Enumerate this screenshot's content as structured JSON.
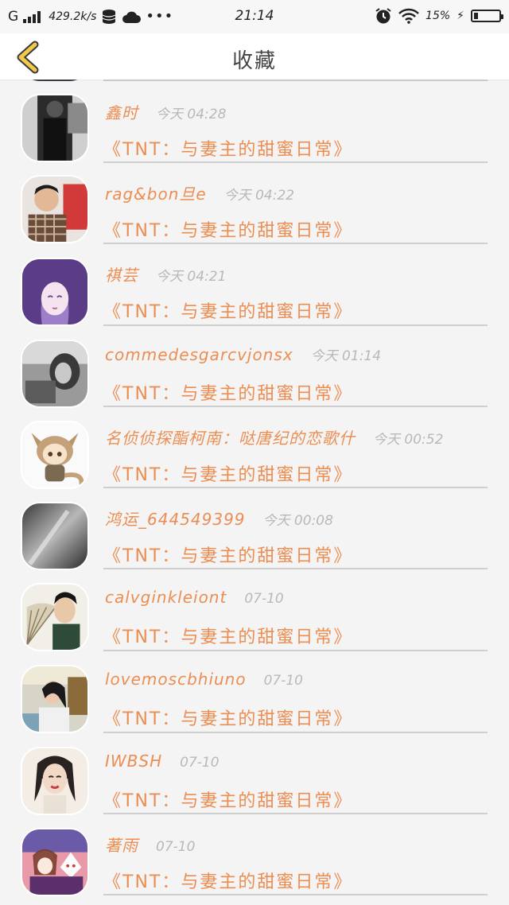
{
  "status_bar": {
    "network": "G",
    "speed": "429.2k/s",
    "time": "21:14",
    "battery": "15%",
    "battery_level": 0.15
  },
  "nav": {
    "title": "收藏"
  },
  "colors": {
    "accent": "#ec8d52",
    "back_arrow": "#f2c94c",
    "divider": "#cfcfcf",
    "time_text": "#b8b8b8"
  },
  "items": [
    {
      "name": "鑫时",
      "time": "今天 04:28",
      "title": "《TNT：与妻主的甜蜜日常》",
      "avatar": "avatar-dark-man"
    },
    {
      "name": "rag&bon旦e",
      "time": "今天 04:22",
      "title": "《TNT：与妻主的甜蜜日常》",
      "avatar": "avatar-boy-red"
    },
    {
      "name": "祺芸",
      "time": "今天 04:21",
      "title": "《TNT：与妻主的甜蜜日常》",
      "avatar": "avatar-anime-purple"
    },
    {
      "name": "commedesgarcvjonsx",
      "time": "今天 01:14",
      "title": "《TNT：与妻主的甜蜜日常》",
      "avatar": "avatar-bw-girl"
    },
    {
      "name": "名侦侦探酯柯南：哒唐纪的恋歌什",
      "time": "今天 00:52",
      "title": "《TNT：与妻主的甜蜜日常》",
      "avatar": "avatar-chibi-fox"
    },
    {
      "name": "鸿运_644549399",
      "time": "今天 00:08",
      "title": "《TNT：与妻主的甜蜜日常》",
      "avatar": "avatar-gray-blur"
    },
    {
      "name": "calvginkleiont",
      "time": "07-10",
      "title": "《TNT：与妻主的甜蜜日常》",
      "avatar": "avatar-fan-woman"
    },
    {
      "name": "lovemoscbhiuno",
      "time": "07-10",
      "title": "《TNT：与妻主的甜蜜日常》",
      "avatar": "avatar-car-girl"
    },
    {
      "name": "IWBSH",
      "time": "07-10",
      "title": "《TNT：与妻主的甜蜜日常》",
      "avatar": "avatar-sketch-girl"
    },
    {
      "name": "著雨",
      "time": "07-10",
      "title": "《TNT：与妻主的甜蜜日常》",
      "avatar": "avatar-anime-fox-mask"
    }
  ]
}
